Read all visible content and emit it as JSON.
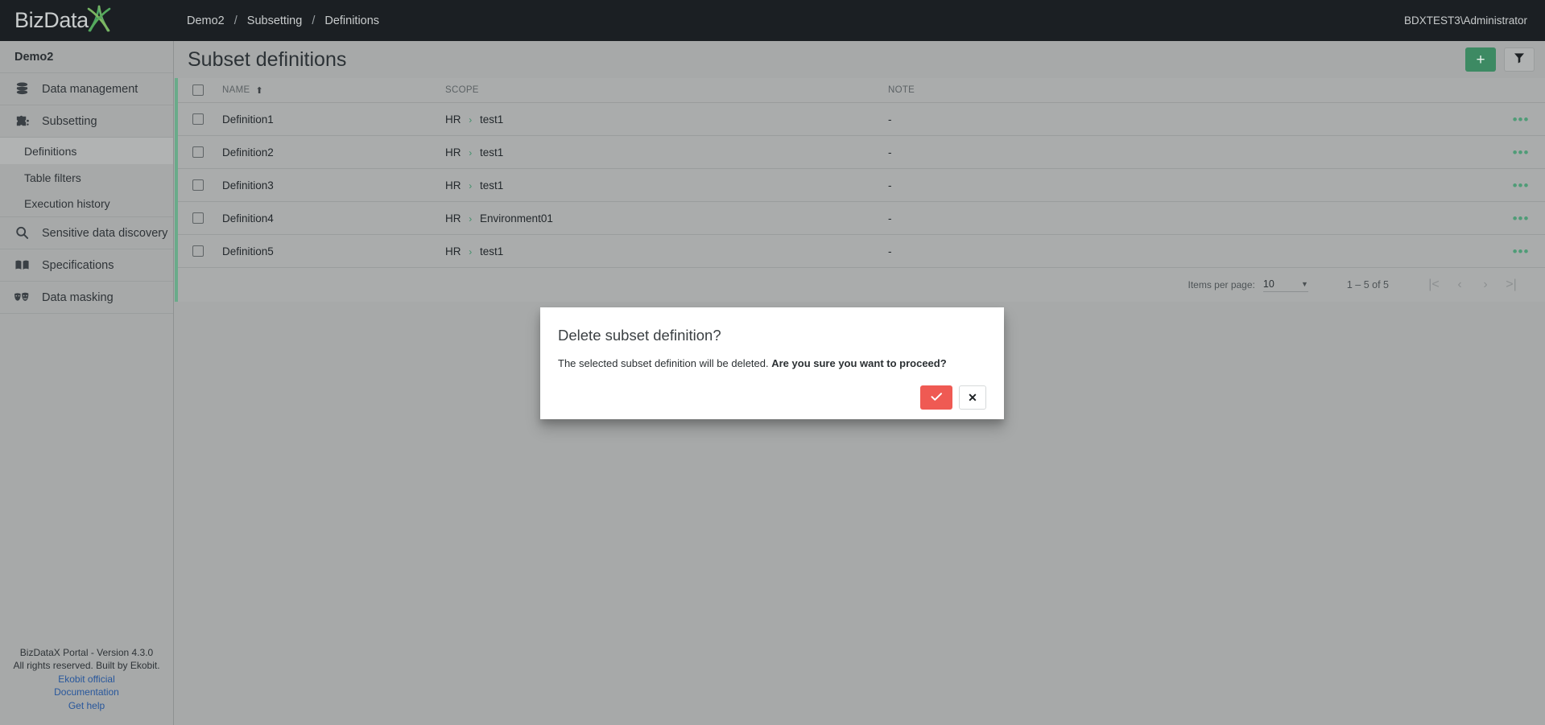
{
  "topbar": {
    "logo_text": "BizData",
    "logo_x_icon": "logo-x-icon",
    "breadcrumb": [
      "Demo2",
      "Subsetting",
      "Definitions"
    ],
    "breadcrumb_separator": "/",
    "user": "BDXTEST3\\Administrator"
  },
  "sidebar": {
    "project": "Demo2",
    "items": [
      {
        "label": "Data management",
        "icon": "database-icon",
        "active": false
      },
      {
        "label": "Subsetting",
        "icon": "puzzle-piece-icon",
        "active": false
      },
      {
        "label": "Sensitive data discovery",
        "icon": "magnifier-icon",
        "active": false
      },
      {
        "label": "Specifications",
        "icon": "book-icon",
        "active": false
      },
      {
        "label": "Data masking",
        "icon": "theater-masks-icon",
        "active": false
      }
    ],
    "sub_items": [
      {
        "label": "Definitions",
        "active": true
      },
      {
        "label": "Table filters",
        "active": false
      },
      {
        "label": "Execution history",
        "active": false
      }
    ],
    "footer": {
      "version": "BizDataX Portal - Version 4.3.0",
      "rights": "All rights reserved. Built by Ekobit.",
      "links": [
        "Ekobit official",
        "Documentation",
        "Get help"
      ]
    }
  },
  "main": {
    "title": "Subset definitions",
    "add_button_label": "+",
    "filter_button_icon": "funnel-icon",
    "table": {
      "columns": [
        "NAME",
        "SCOPE",
        "NOTE"
      ],
      "sort_column": "NAME",
      "sort_direction_icon": "arrow-up-icon",
      "rows": [
        {
          "name": "Definition1",
          "scope_root": "HR",
          "scope_child": "test1",
          "note": "-"
        },
        {
          "name": "Definition2",
          "scope_root": "HR",
          "scope_child": "test1",
          "note": "-"
        },
        {
          "name": "Definition3",
          "scope_root": "HR",
          "scope_child": "test1",
          "note": "-"
        },
        {
          "name": "Definition4",
          "scope_root": "HR",
          "scope_child": "Environment01",
          "note": "-"
        },
        {
          "name": "Definition5",
          "scope_root": "HR",
          "scope_child": "test1",
          "note": "-"
        }
      ],
      "row_menu_icon": "kebab-menu-icon",
      "scope_separator": "›"
    },
    "pagination": {
      "items_per_page_label": "Items per page:",
      "items_per_page_value": "10",
      "range_label": "1 – 5 of 5",
      "first_page_icon": "|<",
      "prev_page_icon": "‹",
      "next_page_icon": "›",
      "last_page_icon": ">|"
    }
  },
  "dialog": {
    "title": "Delete subset definition?",
    "body_text": "The selected subset definition will be deleted.",
    "body_emphasis": "Are you sure you want to proceed?",
    "confirm_icon": "check-icon",
    "cancel_icon": "close-icon"
  },
  "colors": {
    "topbar_bg": "#1b1f23",
    "page_bg": "#a7a9a9",
    "accent_green": "#3d8a63",
    "card_accent": "#6aab8a",
    "danger_red": "#ef5a53",
    "link_blue": "#28579c"
  }
}
